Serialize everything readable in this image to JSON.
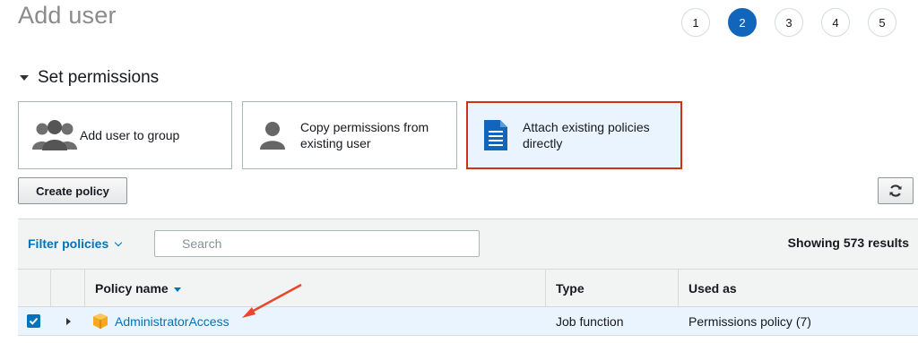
{
  "page": {
    "title": "Add user"
  },
  "steps": [
    "1",
    "2",
    "3",
    "4",
    "5"
  ],
  "active_step": 2,
  "section": {
    "title": "Set permissions"
  },
  "permission_options": {
    "group": "Add user to group",
    "copy_line1": "Copy permissions from",
    "copy_line2": "existing user",
    "attach_line1": "Attach existing policies",
    "attach_line2": "directly",
    "selected": "attach"
  },
  "toolbar": {
    "create_policy": "Create policy",
    "refresh_icon": "refresh-icon"
  },
  "filter": {
    "label": "Filter policies",
    "search_placeholder": "Search",
    "results": "Showing 573 results"
  },
  "table": {
    "columns": {
      "policy_name": "Policy name",
      "type": "Type",
      "used_as": "Used as"
    },
    "rows": [
      {
        "checked": true,
        "name": "AdministratorAccess",
        "type": "Job function",
        "used_as": "Permissions policy (7)"
      }
    ]
  },
  "colors": {
    "accent": "#1166bb",
    "link": "#0073bb",
    "selection_border": "#d13212",
    "selected_bg": "#e9f4ff",
    "annotation_arrow": "#e8472b"
  }
}
